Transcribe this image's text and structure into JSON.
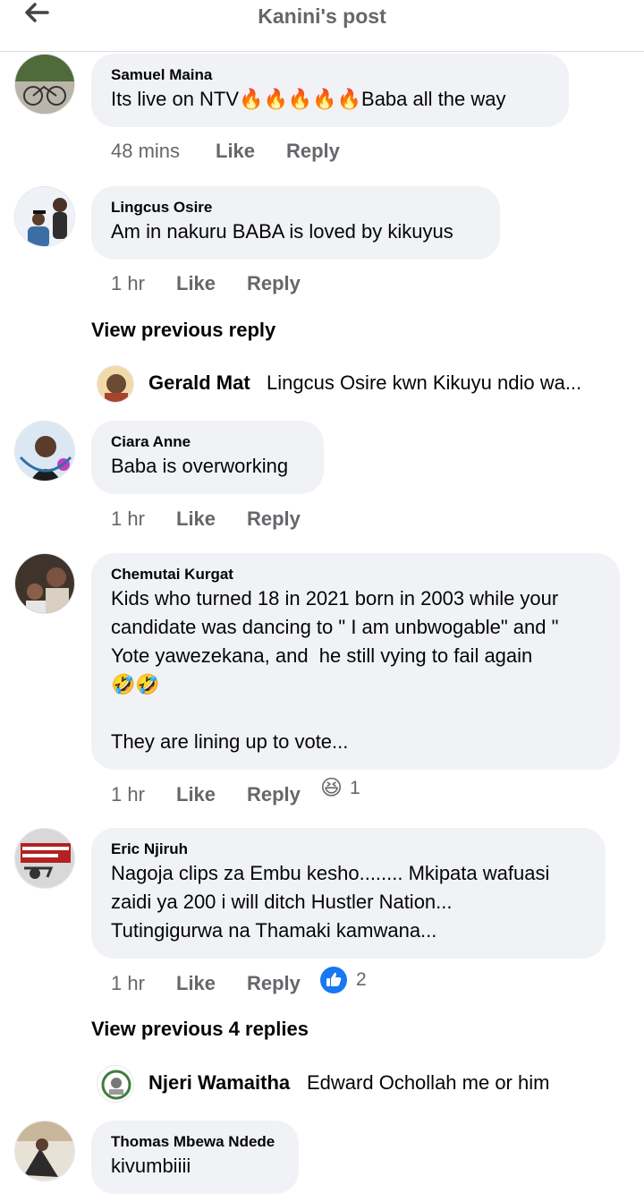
{
  "header": {
    "title": "Kanini's post"
  },
  "comments": [
    {
      "name": "Samuel Maina",
      "text_before": "Its live on NTV",
      "emoji": "🔥🔥🔥🔥🔥",
      "text_after": "Baba all the way",
      "time": "48 mins",
      "like": "Like",
      "reply": "Reply"
    },
    {
      "name": "Lingcus Osire",
      "text": "Am in nakuru BABA is loved by kikuyus",
      "time": "1 hr",
      "like": "Like",
      "reply": "Reply",
      "view_previous": "View previous reply",
      "reply_preview": {
        "name": "Gerald Mat",
        "text": "Lingcus Osire kwn Kikuyu ndio wa..."
      }
    },
    {
      "name": "Ciara Anne",
      "text": "Baba is overworking",
      "time": "1 hr",
      "like": "Like",
      "reply": "Reply"
    },
    {
      "name": "Chemutai Kurgat",
      "line1": "Kids who turned 18 in 2021 born in 2003 while your",
      "line2": "candidate was dancing to \" I am unbwogable\" and \"",
      "line3": "Yote yawezekana, and  he still vying to fail again",
      "emoji": "🤣🤣",
      "line5": "They are lining up to vote...",
      "time": "1 hr",
      "like": "Like",
      "reply": "Reply",
      "reaction": {
        "icon": "😆",
        "count": "1"
      }
    },
    {
      "name": "Eric Njiruh",
      "line1": "Nagoja clips za Embu kesho........ Mkipata wafuasi",
      "line2": "zaidi ya 200 i will ditch Hustler Nation...",
      "line3": "Tutingigurwa na Thamaki kamwana...",
      "time": "1 hr",
      "like": "Like",
      "reply": "Reply",
      "reaction": {
        "icon": "like-reaction-icon",
        "count": "2"
      },
      "view_previous": "View previous 4 replies",
      "reply_preview": {
        "name": "Njeri Wamaitha",
        "text": "Edward Ochollah me or him"
      }
    },
    {
      "name": "Thomas Mbewa Ndede",
      "text": "kivumbiiii"
    }
  ],
  "colors": {
    "bubble": "#f0f2f5",
    "meta": "#65676b",
    "like_blue": "#1877f2"
  }
}
